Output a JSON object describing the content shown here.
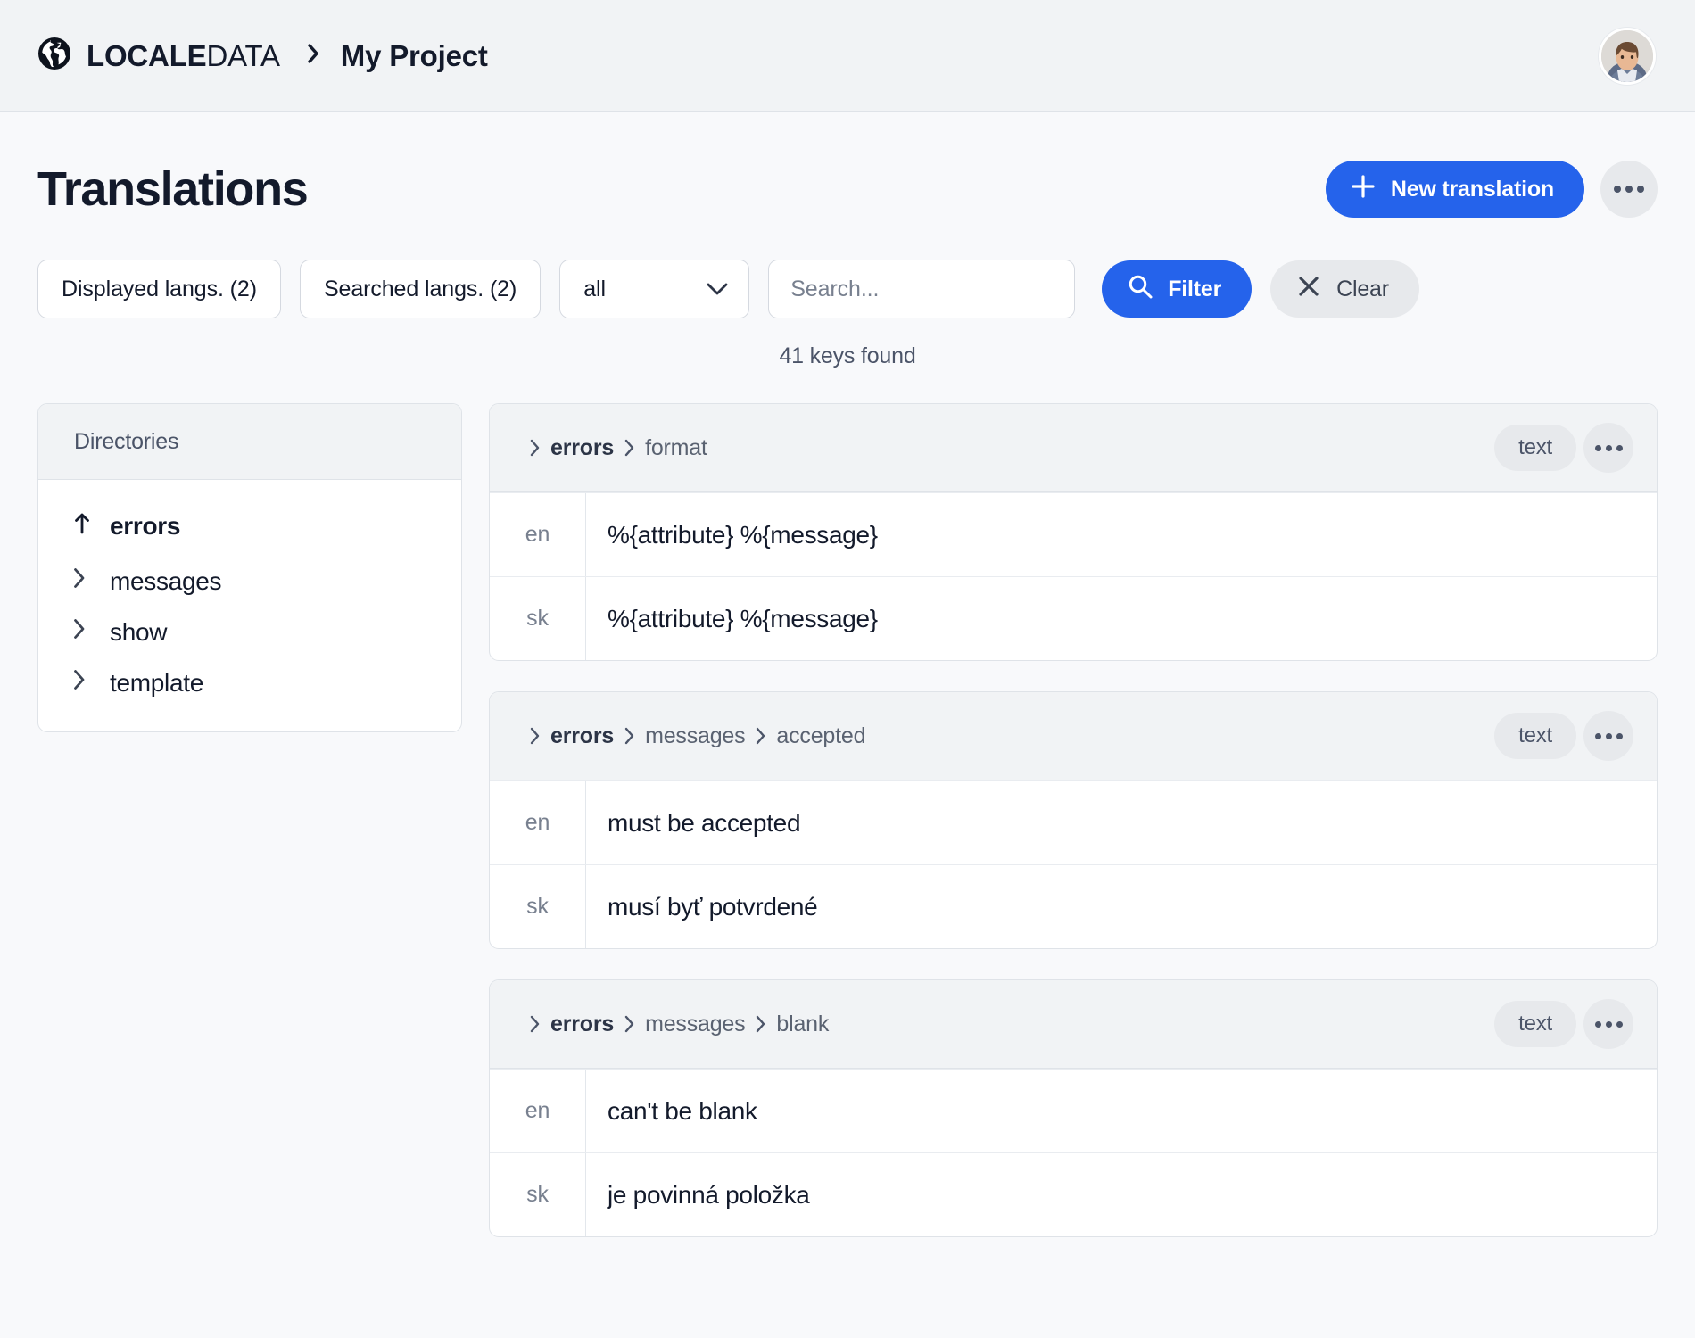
{
  "navbar": {
    "logo_icon": "globe-icon",
    "brand_strong": "LOCALE",
    "brand_light": "DATA",
    "separator": "›",
    "project": "My Project",
    "avatar_icon": "user-avatar"
  },
  "page": {
    "title": "Translations",
    "new_translation_label": "New translation",
    "more_label": "…"
  },
  "filters": {
    "displayed_langs": "Displayed langs. (2)",
    "searched_langs": "Searched langs. (2)",
    "scope_selected": "all",
    "scope_options": [
      "all"
    ],
    "search_value": "",
    "search_placeholder": "Search...",
    "filter_label": "Filter",
    "clear_label": "Clear",
    "keys_found": "41 keys found"
  },
  "directories": {
    "header": "Directories",
    "items": [
      {
        "label": "errors",
        "icon": "arrow-up-icon",
        "is_parent": true
      },
      {
        "label": "messages",
        "icon": "chevron-right-icon",
        "is_parent": false
      },
      {
        "label": "show",
        "icon": "chevron-right-icon",
        "is_parent": false
      },
      {
        "label": "template",
        "icon": "chevron-right-icon",
        "is_parent": false
      }
    ]
  },
  "translations": {
    "cards": [
      {
        "crumb_root": "errors",
        "crumb_parts": [
          "format"
        ],
        "tag": "text",
        "rows": [
          {
            "lang": "en",
            "value": "%{attribute} %{message}"
          },
          {
            "lang": "sk",
            "value": "%{attribute} %{message}"
          }
        ]
      },
      {
        "crumb_root": "errors",
        "crumb_parts": [
          "messages",
          "accepted"
        ],
        "tag": "text",
        "rows": [
          {
            "lang": "en",
            "value": "must be accepted"
          },
          {
            "lang": "sk",
            "value": "musí byť potvrdené"
          }
        ]
      },
      {
        "crumb_root": "errors",
        "crumb_parts": [
          "messages",
          "blank"
        ],
        "tag": "text",
        "rows": [
          {
            "lang": "en",
            "value": "can't be blank"
          },
          {
            "lang": "sk",
            "value": "je povinná položka"
          }
        ]
      }
    ]
  },
  "colors": {
    "accent": "#2563eb",
    "page_bg": "#f8f9fb",
    "navbar_bg": "#f1f3f5",
    "text": "#131a2b",
    "muted": "#78808f",
    "chip_bg": "#e7e9ec",
    "border": "#dfe3e8"
  }
}
